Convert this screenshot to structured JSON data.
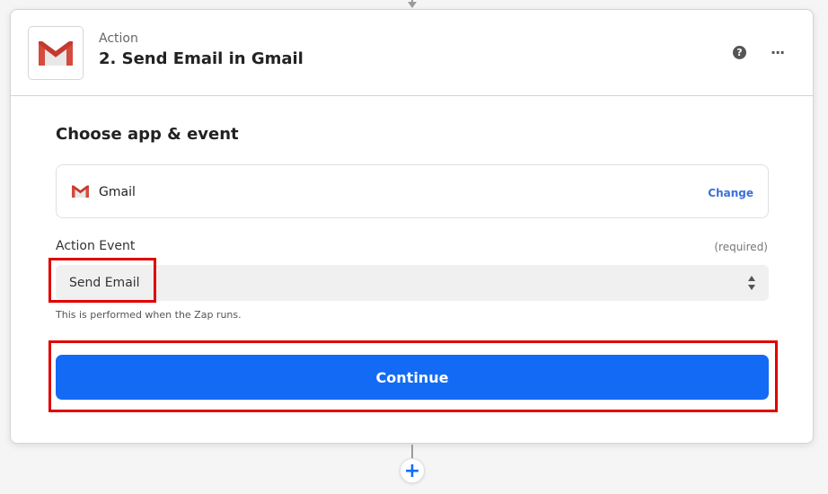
{
  "step": {
    "type_label": "Action",
    "title": "2. Send Email in Gmail",
    "help_icon": "question-circle-icon",
    "more_icon": "more-horizontal-icon",
    "app_icon": "gmail-logo-icon"
  },
  "section": {
    "title": "Choose app & event"
  },
  "app_select": {
    "app_name": "Gmail",
    "change_label": "Change",
    "icon": "gmail-logo-icon"
  },
  "action_event": {
    "label": "Action Event",
    "required_text": "(required)",
    "value": "Send Email",
    "help_text": "This is performed when the Zap runs.",
    "icon": "updown-arrows-icon"
  },
  "continue_label": "Continue",
  "add_step_icon": "plus-icon",
  "colors": {
    "primary": "#136bf5",
    "link": "#3d6fd9",
    "highlight": "#e00000",
    "gmail_red": "#d54b3d"
  }
}
